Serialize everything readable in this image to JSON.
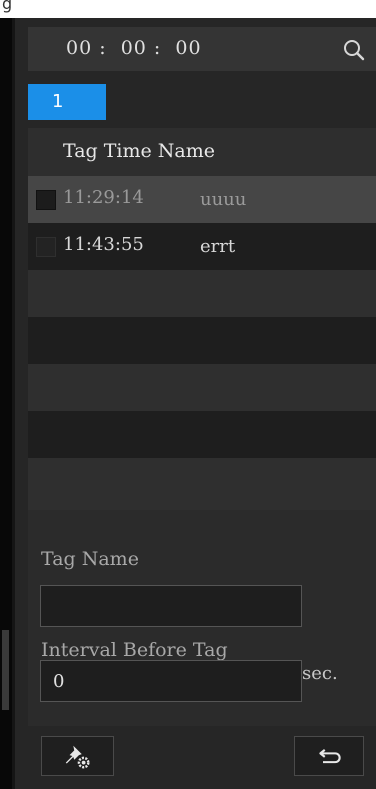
{
  "header": {
    "time": "00 :  00 :  00",
    "search_icon": "search-icon"
  },
  "tabs": [
    {
      "label": "1",
      "active": true
    }
  ],
  "table": {
    "header": "Tag Time Name",
    "rows": [
      {
        "time": "11:29:14",
        "name": "uuuu",
        "selected": true
      },
      {
        "time": "11:43:55",
        "name": "errt",
        "selected": false
      }
    ]
  },
  "form": {
    "tag_name_label": "Tag Name",
    "tag_name_value": "",
    "interval_label": "Interval Before Tag",
    "interval_value": "0",
    "interval_unit": "sec."
  },
  "toolbar": {
    "settings_icon": "pin-gear-icon",
    "back_icon": "return-icon"
  },
  "colors": {
    "accent": "#1b8fe8",
    "panel": "#262626"
  }
}
